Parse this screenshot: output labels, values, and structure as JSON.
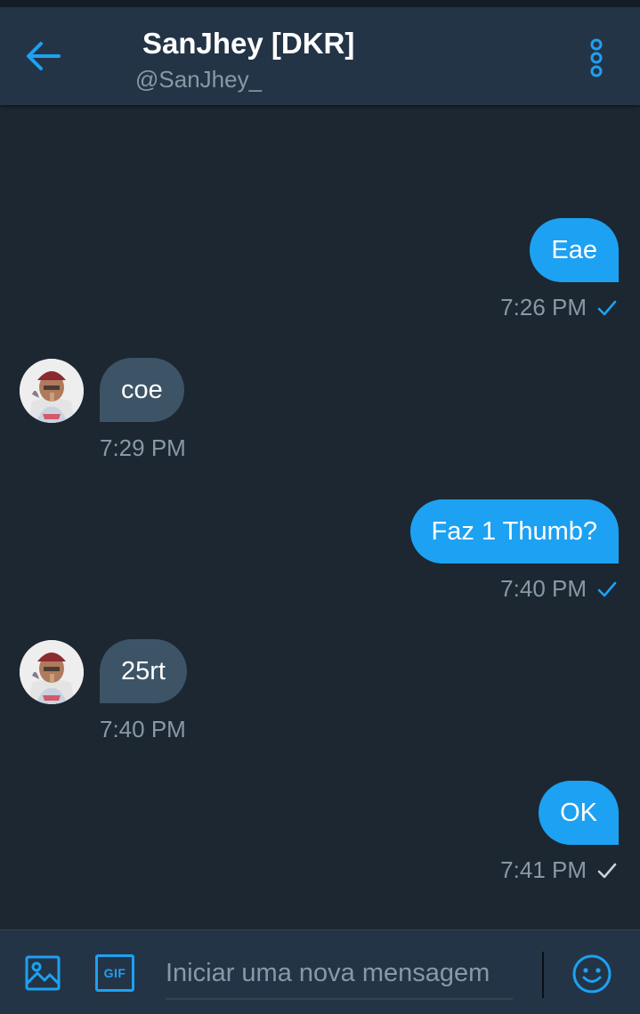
{
  "header": {
    "title": "SanJhey [DKR]",
    "handle": "@SanJhey_",
    "back_icon": "arrow-left-icon",
    "more_icon": "more-vertical-icon"
  },
  "messages": [
    {
      "direction": "outgoing",
      "text": "Eae",
      "time": "7:26 PM",
      "status": "read"
    },
    {
      "direction": "incoming",
      "text": "coe",
      "time": "7:29 PM"
    },
    {
      "direction": "outgoing",
      "text": "Faz 1 Thumb?",
      "time": "7:40 PM",
      "status": "read"
    },
    {
      "direction": "incoming",
      "text": "25rt",
      "time": "7:40 PM"
    },
    {
      "direction": "outgoing",
      "text": "OK",
      "time": "7:41 PM",
      "status": "sent"
    }
  ],
  "composer": {
    "placeholder": "Iniciar uma nova mensagem",
    "image_icon": "image-icon",
    "gif_label": "GIF",
    "emoji_icon": "emoji-icon"
  },
  "colors": {
    "accent": "#1da1f2",
    "background": "#1c2732",
    "header": "#243447",
    "incoming_bubble": "#3d5466",
    "secondary_text": "#8899a6"
  }
}
